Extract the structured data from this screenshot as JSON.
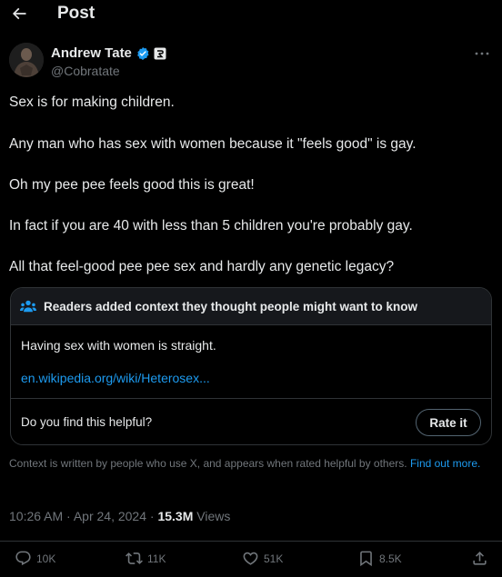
{
  "header": {
    "title": "Post"
  },
  "author": {
    "name": "Andrew Tate",
    "handle": "@Cobratate"
  },
  "post": {
    "lines": [
      "Sex is for making children.",
      "Any man who has sex with women because it \"feels good\" is gay.",
      "Oh my pee pee feels good this is great!",
      "In fact if you are 40 with less than 5 children you're probably gay.",
      "All that feel-good pee pee sex and hardly any genetic legacy?"
    ]
  },
  "community_note": {
    "heading": "Readers added context they thought people might want to know",
    "text": "Having sex with women is straight.",
    "link": "en.wikipedia.org/wiki/Heterosex...",
    "question": "Do you find this helpful?",
    "rate_label": "Rate it"
  },
  "context_footer": {
    "text": "Context is written by people who use X, and appears when rated helpful by others.",
    "link": "Find out more."
  },
  "meta": {
    "time": "10:26 AM",
    "date": "Apr 24, 2024",
    "views_count": "15.3M",
    "views_label": "Views"
  },
  "actions": {
    "replies": "10K",
    "reposts": "11K",
    "likes": "51K",
    "bookmarks": "8.5K"
  },
  "icons": [
    "back-arrow-icon",
    "verified-badge-icon",
    "affiliate-badge-icon",
    "more-icon",
    "readers-icon",
    "reply-icon",
    "repost-icon",
    "like-icon",
    "bookmark-icon",
    "share-icon"
  ],
  "colors": {
    "background": "#000000",
    "text": "#e7e9ea",
    "secondary": "#71767b",
    "accent": "#1d9bf0",
    "border": "#2f3336"
  }
}
